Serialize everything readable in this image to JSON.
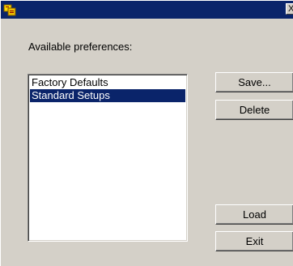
{
  "window": {
    "title": "",
    "close_glyph": "X",
    "icon": "app-icon"
  },
  "preferences": {
    "label": "Available preferences:",
    "items": [
      {
        "label": "Factory Defaults",
        "selected": false
      },
      {
        "label": "Standard Setups",
        "selected": true
      }
    ]
  },
  "buttons": {
    "save": "Save...",
    "delete": "Delete",
    "load": "Load",
    "exit": "Exit"
  },
  "colors": {
    "titlebar": "#0a246a",
    "selection": "#0a246a",
    "face": "#d4d0c8"
  }
}
